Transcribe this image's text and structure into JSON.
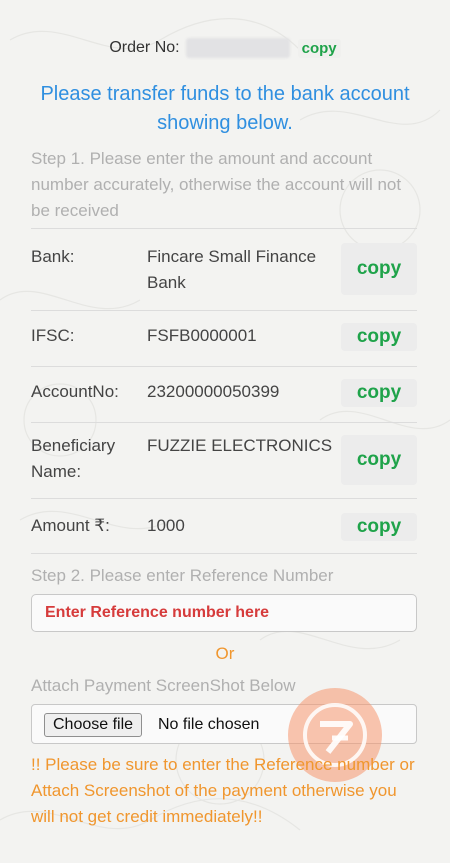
{
  "order": {
    "label": "Order No:",
    "copy_label": "copy"
  },
  "notice": "Please transfer funds to the bank account showing below.",
  "step1": "Step 1. Please enter the amount and account number accurately, otherwise the account will not be received",
  "details": [
    {
      "label": "Bank:",
      "value": "Fincare Small Finance Bank",
      "copy": "copy"
    },
    {
      "label": "IFSC:",
      "value": "FSFB0000001",
      "copy": "copy"
    },
    {
      "label": "AccountNo:",
      "value": "23200000050399",
      "copy": "copy"
    },
    {
      "label": "Beneficiary Name:",
      "value": "FUZZIE ELECTRONICS",
      "copy": "copy"
    },
    {
      "label": "Amount ₹:",
      "value": "1000",
      "copy": "copy"
    }
  ],
  "step2": "Step 2. Please enter Reference Number",
  "reference_input": {
    "placeholder": "Enter Reference number here",
    "value": ""
  },
  "or_label": "Or",
  "attach_label": "Attach Payment ScreenShot Below",
  "file_input": {
    "button_label": "Choose file",
    "status": "No file chosen"
  },
  "warning": "!! Please be sure to enter the Reference number or Attach Screenshot of the payment otherwise you will not get credit immediately!!",
  "colors": {
    "accent_blue": "#2f8fe0",
    "copy_green": "#1fa34a",
    "warning_orange": "#f0962e",
    "placeholder_red": "#d63b3b"
  },
  "icons": {
    "floating_badge": "logo-badge-icon"
  }
}
